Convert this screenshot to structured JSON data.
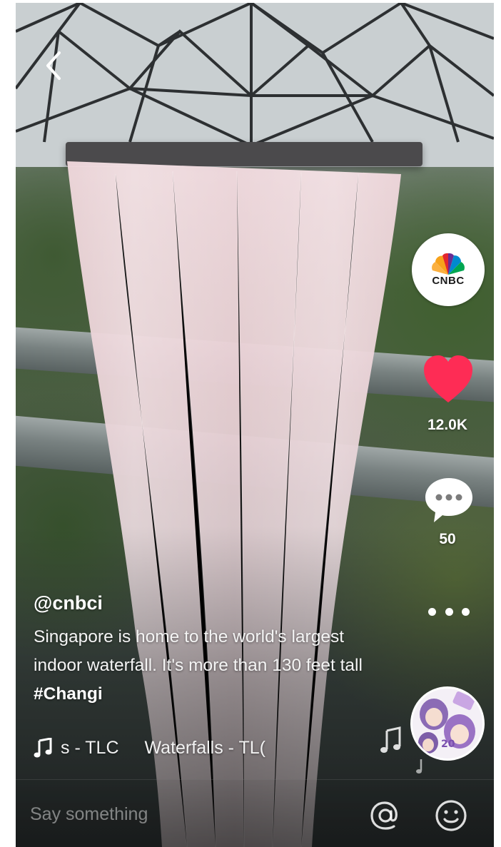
{
  "creator": {
    "username": "@cnbci",
    "avatar_label": "CNBC"
  },
  "post": {
    "caption_text": "Singapore is home to the world's largest indoor waterfall. It's more than 130 feet tall ",
    "hashtag": "#Changi"
  },
  "stats": {
    "likes": "12.0K",
    "comments": "50"
  },
  "music": {
    "ticker_fragment": "s - TLC",
    "track_title": "Waterfalls - TL("
  },
  "comment_bar": {
    "placeholder": "Say something"
  },
  "icons": {
    "back": "chevron-left-icon",
    "like": "heart-icon",
    "comment": "speech-bubble-icon",
    "more": "more-dots-icon",
    "music": "music-note-icon",
    "mention": "at-sign-icon",
    "emoji": "smiley-icon"
  },
  "colors": {
    "like_active": "#fe2c55",
    "text_primary": "#ffffff"
  }
}
